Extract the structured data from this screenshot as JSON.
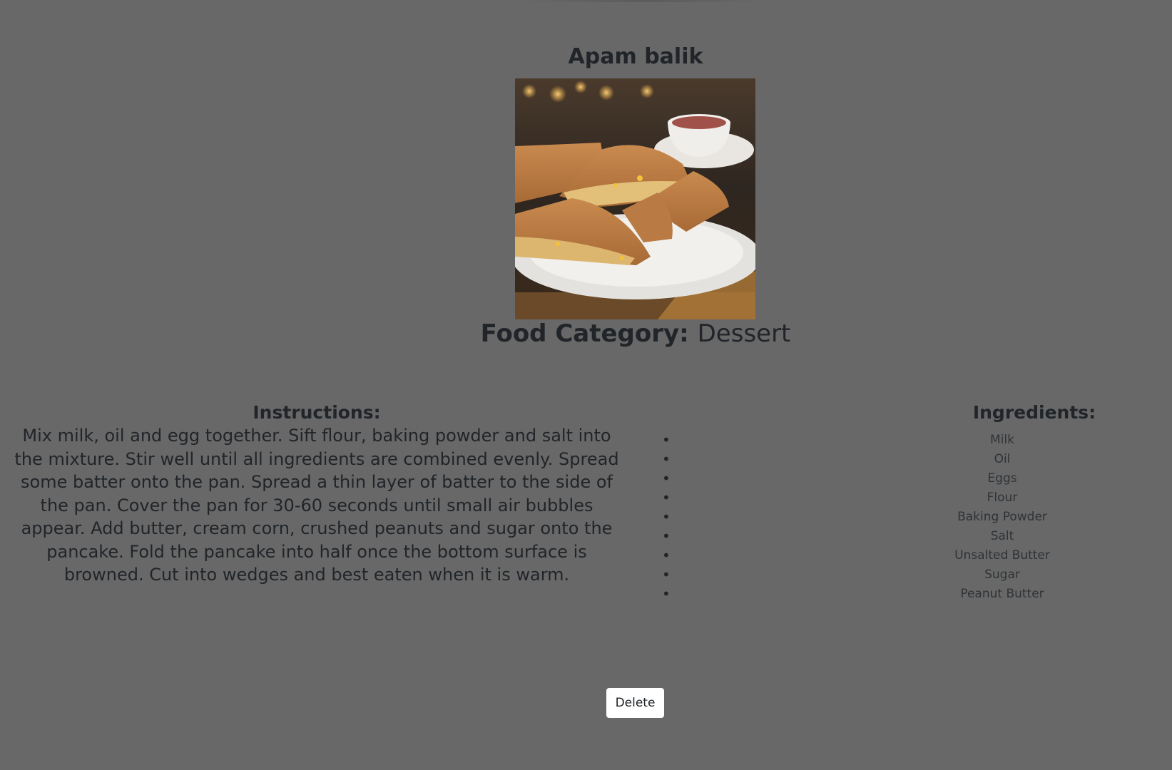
{
  "recipe": {
    "title": "Apam balik",
    "image_alt": "Apam balik",
    "category_label": "Food Category:",
    "category_value": "Dessert"
  },
  "instructions": {
    "heading": "Instructions:",
    "text": "Mix milk, oil and egg together. Sift flour, baking powder and salt into the mixture. Stir well until all ingredients are combined evenly. Spread some batter onto the pan. Spread a thin layer of batter to the side of the pan. Cover the pan for 30-60 seconds until small air bubbles appear. Add butter, cream corn, crushed peanuts and sugar onto the pancake. Fold the pancake into half once the bottom surface is browned. Cut into wedges and best eaten when it is warm."
  },
  "ingredients": {
    "heading": "Ingredients:",
    "items": [
      "Milk",
      "Oil",
      "Eggs",
      "Flour",
      "Baking Powder",
      "Salt",
      "Unsalted Butter",
      "Sugar",
      "Peanut Butter"
    ]
  },
  "actions": {
    "delete_label": "Delete"
  },
  "colors": {
    "background": "#686868",
    "text": "#212529",
    "button_bg": "#ffffff"
  }
}
